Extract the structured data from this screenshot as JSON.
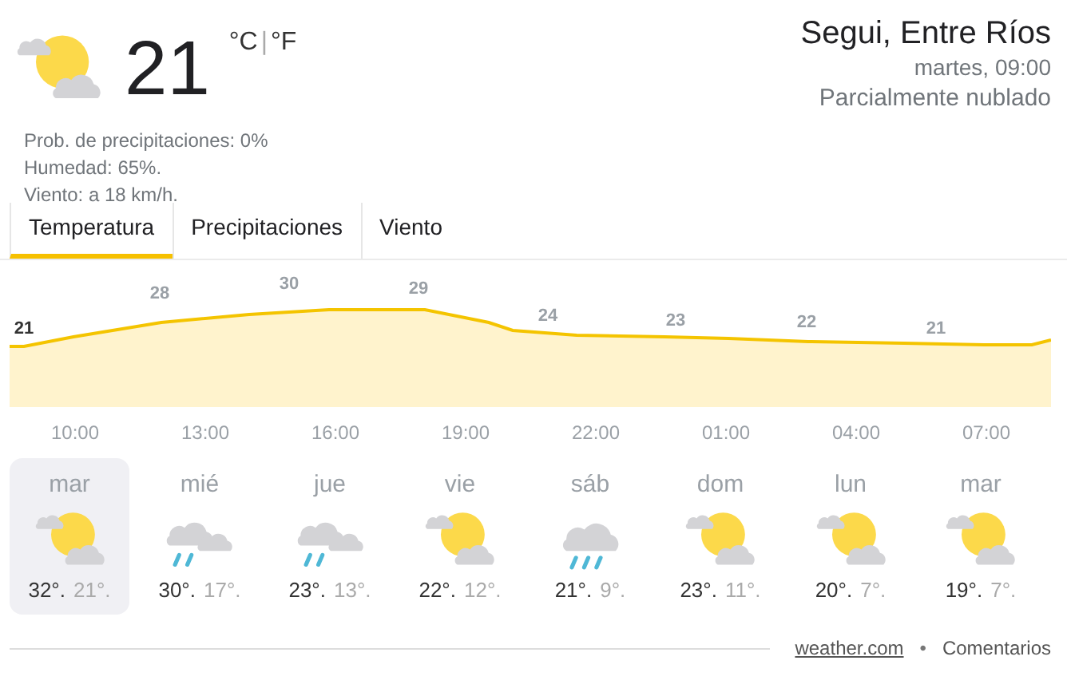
{
  "current": {
    "kind": "partly-cloudy",
    "temperature": "21",
    "unit_celsius": "°C",
    "unit_separator": "|",
    "unit_fahrenheit": "°F",
    "details": [
      "Prob. de precipitaciones: 0%",
      "Humedad: 65%.",
      "Viento: a 18 km/h."
    ]
  },
  "location": {
    "name": "Segui, Entre Ríos",
    "time": "martes, 09:00",
    "condition_text": "Parcialmente nublado"
  },
  "tabs": [
    {
      "label": "Temperatura",
      "selected": true
    },
    {
      "label": "Precipitaciones",
      "selected": false
    },
    {
      "label": "Viento",
      "selected": false
    }
  ],
  "temperature_graph": {
    "kind": "picture",
    "temperature_labels": [
      {
        "text": "21",
        "current": true
      },
      {
        "text": "28",
        "current": false
      },
      {
        "text": "30",
        "current": false
      },
      {
        "text": "29",
        "current": false
      },
      {
        "text": "24",
        "current": false
      },
      {
        "text": "23",
        "current": false
      },
      {
        "text": "22",
        "current": false
      },
      {
        "text": "21",
        "current": false
      }
    ],
    "time_labels": [
      "10:00",
      "13:00",
      "16:00",
      "19:00",
      "22:00",
      "01:00",
      "04:00",
      "07:00"
    ]
  },
  "days": [
    {
      "day": "mar",
      "kind": "partly-cloudy",
      "high": "32°.",
      "low": "21°.",
      "selected": true
    },
    {
      "day": "mié",
      "kind": "showers",
      "high": "30°.",
      "low": "17°.",
      "selected": false
    },
    {
      "day": "jue",
      "kind": "showers",
      "high": "23°.",
      "low": "13°.",
      "selected": false
    },
    {
      "day": "vie",
      "kind": "partly-cloudy",
      "high": "22°.",
      "low": "12°.",
      "selected": false
    },
    {
      "day": "sáb",
      "kind": "rain",
      "high": "21°.",
      "low": "9°.",
      "selected": false
    },
    {
      "day": "dom",
      "kind": "partly-cloudy",
      "high": "23°.",
      "low": "11°.",
      "selected": false
    },
    {
      "day": "lun",
      "kind": "partly-cloudy",
      "high": "20°.",
      "low": "7°.",
      "selected": false
    },
    {
      "day": "mar",
      "kind": "partly-cloudy",
      "high": "19°.",
      "low": "7°.",
      "selected": false
    }
  ],
  "footer": {
    "source": "weather.com",
    "separator": "•",
    "feedback": "Comentarios"
  }
}
